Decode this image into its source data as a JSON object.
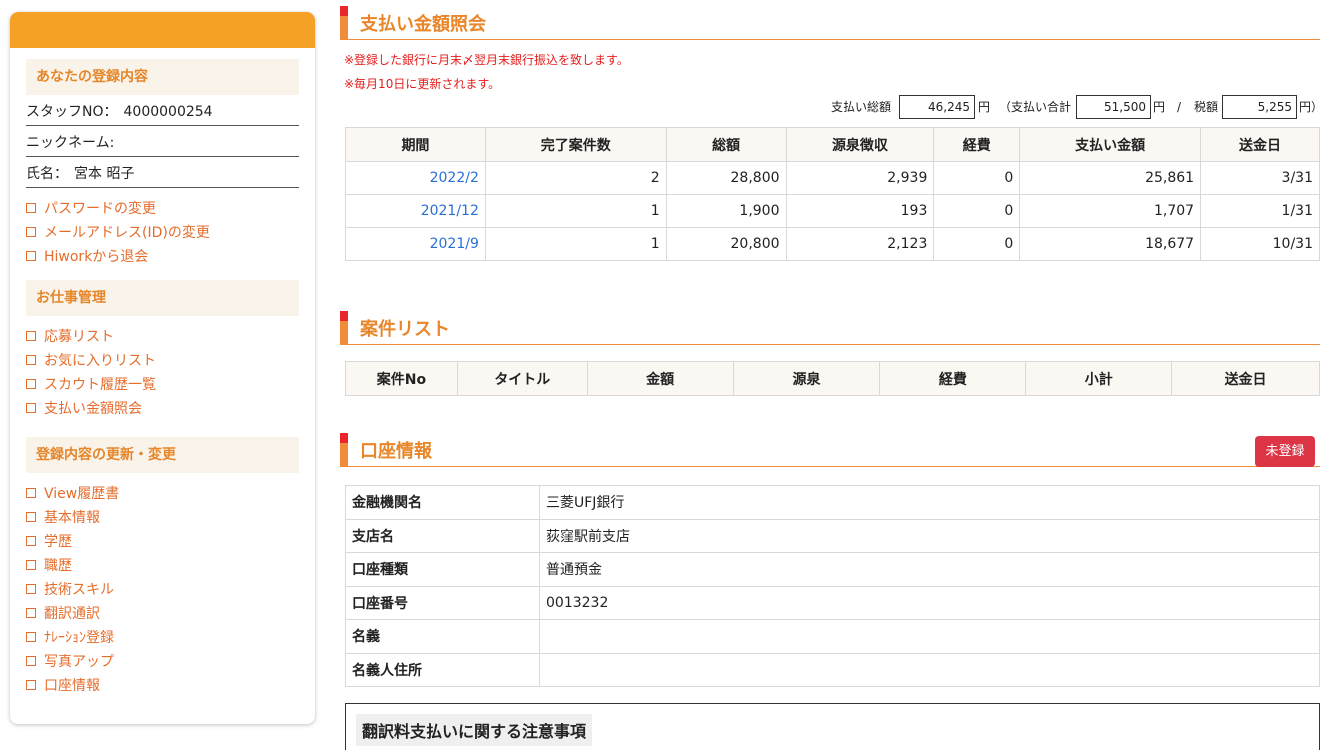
{
  "sidebar": {
    "registration_title": "あなたの登録内容",
    "staff_no_label": "スタッフNO：",
    "staff_no_value": "4000000254",
    "nickname_label": "ニックネーム:",
    "nickname_value": "",
    "name_label": "氏名：",
    "name_value": "宮本 昭子",
    "account_links": [
      "パスワードの変更",
      "メールアドレス(ID)の変更",
      "Hiworkから退会"
    ],
    "work_title": "お仕事管理",
    "work_links": [
      "応募リスト",
      "お気に入りリスト",
      "スカウト履歴一覧",
      "支払い金額照会"
    ],
    "update_title": "登録内容の更新・変更",
    "update_links": [
      "View履歴書",
      "基本情報",
      "学歴",
      "職歴",
      "技術スキル",
      "翻訳通訳",
      "ﾅﾚｰｼｮﾝ登録",
      "写真アップ",
      "口座情報"
    ]
  },
  "payment": {
    "title": "支払い金額照会",
    "notice1": "※登録した銀行に月末〆翌月末銀行振込を致します。",
    "notice2": "※毎月10日に更新されます。",
    "total_label": "支払い総額",
    "total_value": "46,245",
    "yen": "円",
    "subtotal_label": "（支払い合計",
    "subtotal_value": "51,500",
    "slash": "/",
    "tax_label": "税額",
    "tax_value": "5,255",
    "tax_suffix": "円）",
    "columns": [
      "期間",
      "完了案件数",
      "総額",
      "源泉徴収",
      "経費",
      "支払い金額",
      "送金日"
    ],
    "rows": [
      [
        "2022/2",
        "2",
        "28,800",
        "2,939",
        "0",
        "25,861",
        "3/31"
      ],
      [
        "2021/12",
        "1",
        "1,900",
        "193",
        "0",
        "1,707",
        "1/31"
      ],
      [
        "2021/9",
        "1",
        "20,800",
        "2,123",
        "0",
        "18,677",
        "10/31"
      ]
    ]
  },
  "cases": {
    "title": "案件リスト",
    "columns": [
      "案件No",
      "タイトル",
      "金額",
      "源泉",
      "経費",
      "小計",
      "送金日"
    ]
  },
  "account": {
    "title": "口座情報",
    "badge": "未登録",
    "rows": [
      {
        "label": "金融機関名",
        "value": "三菱UFJ銀行"
      },
      {
        "label": "支店名",
        "value": "荻窪駅前支店"
      },
      {
        "label": "口座種類",
        "value": "普通預金"
      },
      {
        "label": "口座番号",
        "value": "0013232"
      },
      {
        "label": "名義",
        "value": ""
      },
      {
        "label": "名義人住所",
        "value": ""
      }
    ]
  },
  "notes": {
    "title": "翻訳料支払いに関する注意事項"
  },
  "colors": {
    "accent_orange": "#f5a125",
    "title_orange": "#e9862a",
    "link_orange": "#e56d2c",
    "notice_red": "#e51c1c",
    "badge_red": "#dc3545",
    "link_blue": "#2a6fd6"
  },
  "icons": {
    "sidebar_link_marker": "checkbox-square-icon"
  }
}
